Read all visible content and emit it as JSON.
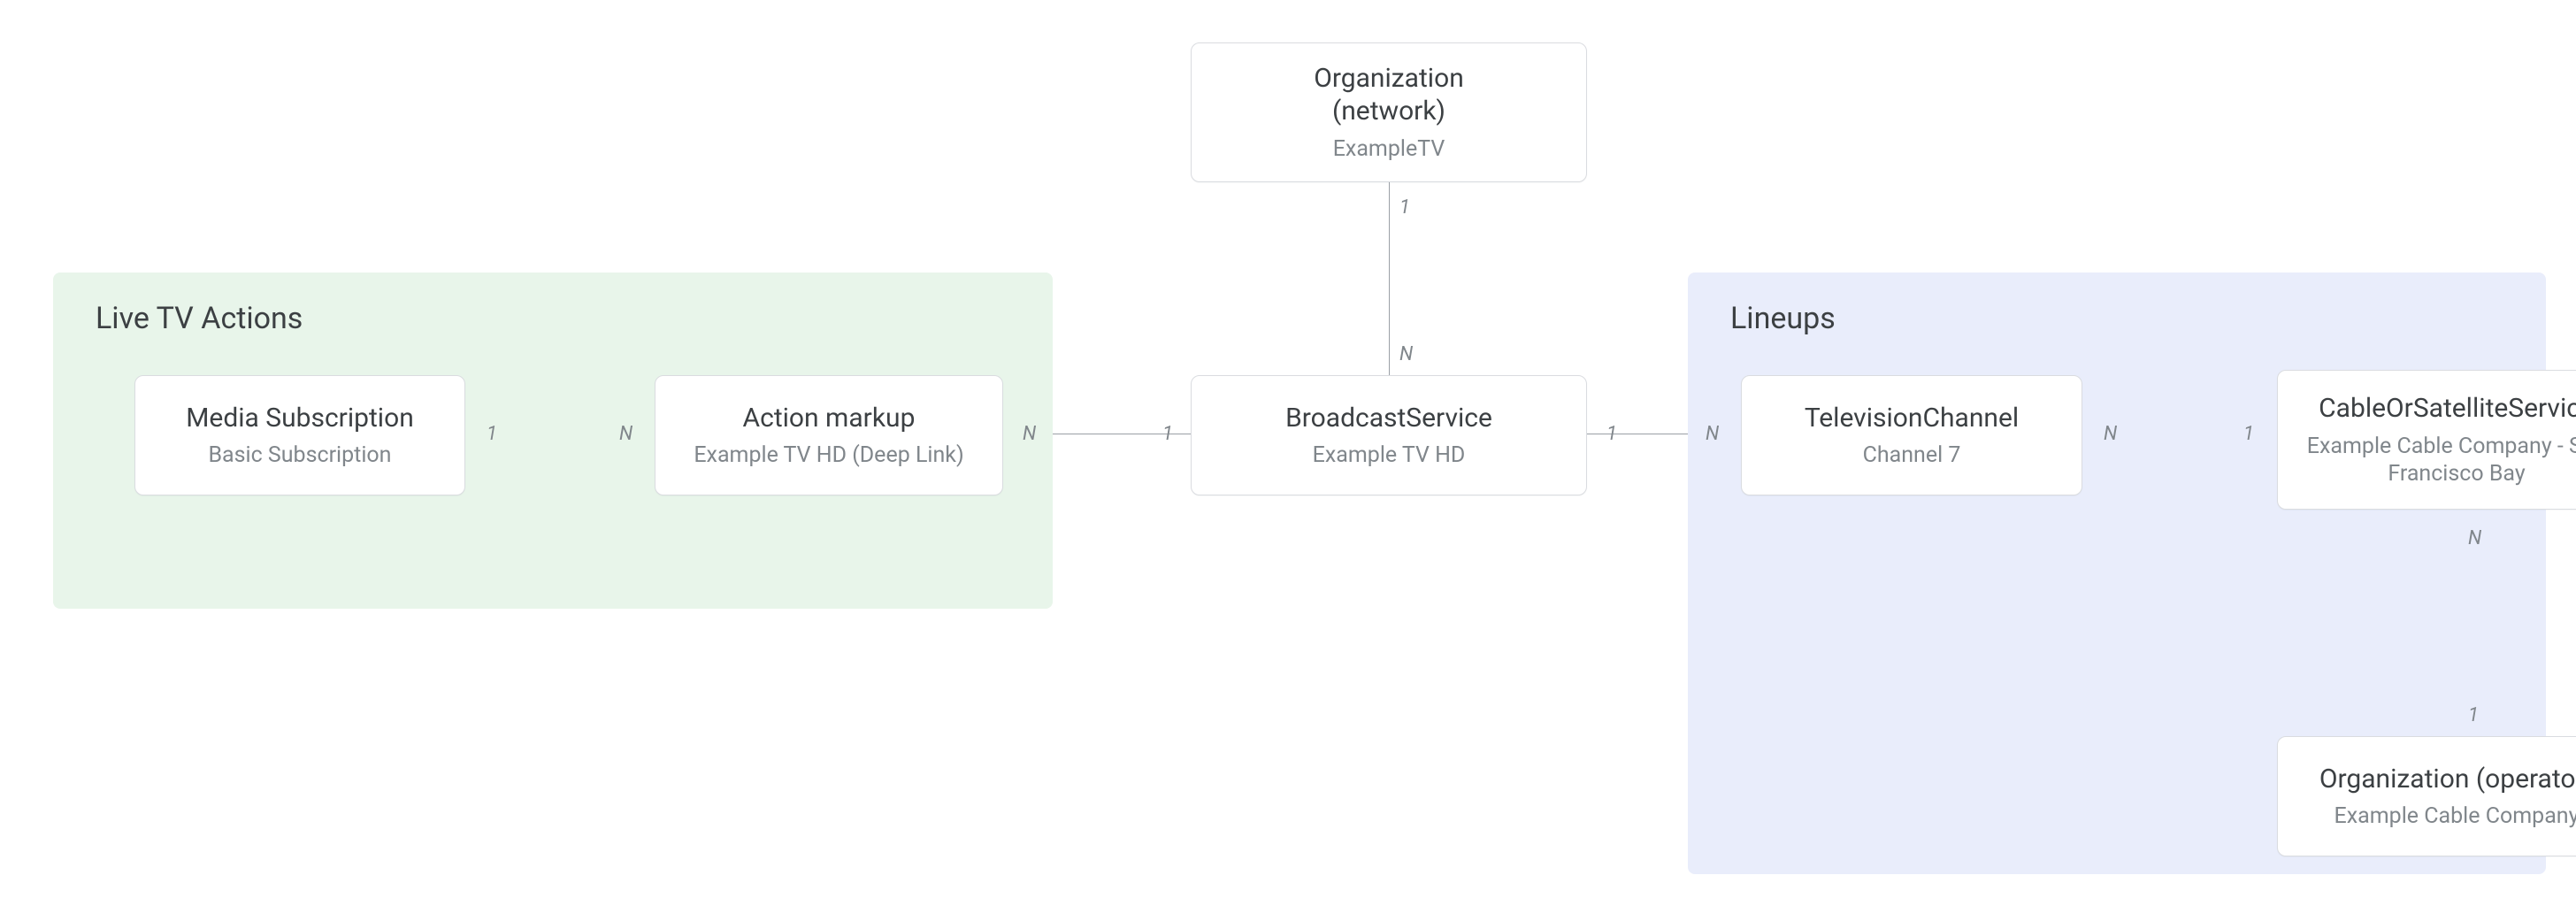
{
  "groups": {
    "live_tv_actions": {
      "title": "Live TV Actions"
    },
    "lineups": {
      "title": "Lineups"
    }
  },
  "nodes": {
    "organization_network": {
      "title": "Organization\n(network)",
      "sub": "ExampleTV"
    },
    "media_subscription": {
      "title": "Media Subscription",
      "sub": "Basic Subscription"
    },
    "action_markup": {
      "title": "Action markup",
      "sub": "Example TV HD (Deep Link)"
    },
    "broadcast_service": {
      "title": "BroadcastService",
      "sub": "Example TV HD"
    },
    "television_channel": {
      "title": "TelevisionChannel",
      "sub": "Channel 7"
    },
    "cable_service": {
      "title": "CableOrSatelliteService",
      "sub": "Example Cable Company - San Francisco Bay"
    },
    "organization_operator": {
      "title": "Organization (operator)",
      "sub": "Example Cable Company"
    }
  },
  "cardinality": {
    "one": "1",
    "many": "N"
  }
}
